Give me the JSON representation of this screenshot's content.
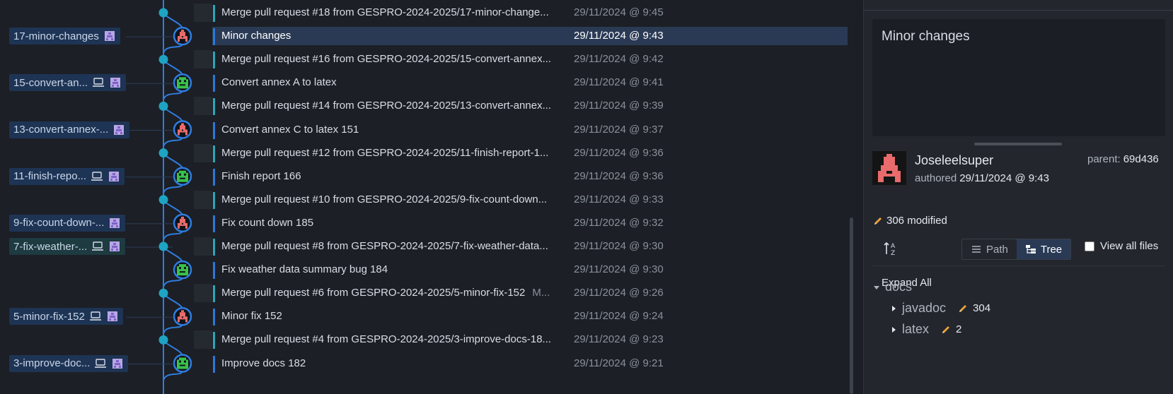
{
  "commits": [
    {
      "message": "Merge pull request #18 from GESPRO-2024-2025/17-minor-change...",
      "tag": "",
      "date": "29/11/2024 @ 9:45",
      "type": "merge",
      "avatar": ""
    },
    {
      "message": "Minor changes",
      "tag": "",
      "date": "29/11/2024 @ 9:43",
      "type": "commit",
      "avatar": "red-avatar-icon",
      "selected": true
    },
    {
      "message": "Merge pull request #16 from GESPRO-2024-2025/15-convert-annex...",
      "tag": "",
      "date": "29/11/2024 @ 9:42",
      "type": "merge",
      "avatar": ""
    },
    {
      "message": "Convert annex A to latex",
      "tag": "",
      "date": "29/11/2024 @ 9:41",
      "type": "commit",
      "avatar": "green-avatar-icon"
    },
    {
      "message": "Merge pull request #14 from GESPRO-2024-2025/13-convert-annex...",
      "tag": "",
      "date": "29/11/2024 @ 9:39",
      "type": "merge",
      "avatar": ""
    },
    {
      "message": "Convert annex C to latex 151",
      "tag": "",
      "date": "29/11/2024 @ 9:37",
      "type": "commit",
      "avatar": "red-avatar-icon"
    },
    {
      "message": "Merge pull request #12 from GESPRO-2024-2025/11-finish-report-1...",
      "tag": "",
      "date": "29/11/2024 @ 9:36",
      "type": "merge",
      "avatar": ""
    },
    {
      "message": "Finish report 166",
      "tag": "",
      "date": "29/11/2024 @ 9:36",
      "type": "commit",
      "avatar": "green-avatar-icon"
    },
    {
      "message": "Merge pull request #10 from GESPRO-2024-2025/9-fix-count-down...",
      "tag": "",
      "date": "29/11/2024 @ 9:33",
      "type": "merge",
      "avatar": ""
    },
    {
      "message": "Fix count down 185",
      "tag": "",
      "date": "29/11/2024 @ 9:32",
      "type": "commit",
      "avatar": "red-avatar-icon"
    },
    {
      "message": "Merge pull request #8 from GESPRO-2024-2025/7-fix-weather-data...",
      "tag": "",
      "date": "29/11/2024 @ 9:30",
      "type": "merge",
      "avatar": ""
    },
    {
      "message": "Fix weather data summary bug 184",
      "tag": "",
      "date": "29/11/2024 @ 9:30",
      "type": "commit",
      "avatar": "green-avatar-icon"
    },
    {
      "message": "Merge pull request #6 from GESPRO-2024-2025/5-minor-fix-152",
      "tag": "M...",
      "date": "29/11/2024 @ 9:26",
      "type": "merge",
      "avatar": ""
    },
    {
      "message": "Minor fix 152",
      "tag": "",
      "date": "29/11/2024 @ 9:24",
      "type": "commit",
      "avatar": "red-avatar-icon"
    },
    {
      "message": "Merge pull request #4 from GESPRO-2024-2025/3-improve-docs-18...",
      "tag": "",
      "date": "29/11/2024 @ 9:23",
      "type": "merge",
      "avatar": ""
    },
    {
      "message": "Improve docs 182",
      "tag": "",
      "date": "29/11/2024 @ 9:21",
      "type": "commit",
      "avatar": "green-avatar-icon"
    }
  ],
  "branches": [
    {
      "name": "17-minor-changes",
      "row": 1,
      "laptop": false,
      "color": "blue"
    },
    {
      "name": "15-convert-an...",
      "row": 3,
      "laptop": true,
      "color": "blue"
    },
    {
      "name": "13-convert-annex-...",
      "row": 5,
      "laptop": false,
      "color": "blue"
    },
    {
      "name": "11-finish-repo...",
      "row": 7,
      "laptop": true,
      "color": "blue"
    },
    {
      "name": "9-fix-count-down-...",
      "row": 9,
      "laptop": false,
      "color": "blue"
    },
    {
      "name": "7-fix-weather-...",
      "row": 10,
      "laptop": true,
      "color": "green"
    },
    {
      "name": "5-minor-fix-152",
      "row": 13,
      "laptop": true,
      "color": "blue"
    },
    {
      "name": "3-improve-doc...",
      "row": 15,
      "laptop": true,
      "color": "blue"
    }
  ],
  "details": {
    "message": "Minor changes",
    "author": "Joseleelsuper",
    "authored_label": "authored",
    "authored_date": "29/11/2024 @ 9:43",
    "parent_label": "parent:",
    "parent_sha": "69d436",
    "modified": "306 modified",
    "path_label": "Path",
    "tree_label": "Tree",
    "view_all_label": "View all files",
    "expand_all": "Expand All",
    "tree": [
      {
        "name": "docs",
        "count": "",
        "expanded": true,
        "depth": 0
      },
      {
        "name": "javadoc",
        "count": "304",
        "expanded": false,
        "depth": 1
      },
      {
        "name": "latex",
        "count": "2",
        "expanded": false,
        "depth": 1
      }
    ]
  },
  "colors": {
    "graph_line": "#2f7de1",
    "merge_node": "#1fa3c2",
    "avatar_red": "#e96b6b",
    "avatar_green": "#39c24a",
    "selected_row": "#2a3a55",
    "pencil": "#e8a33a"
  }
}
